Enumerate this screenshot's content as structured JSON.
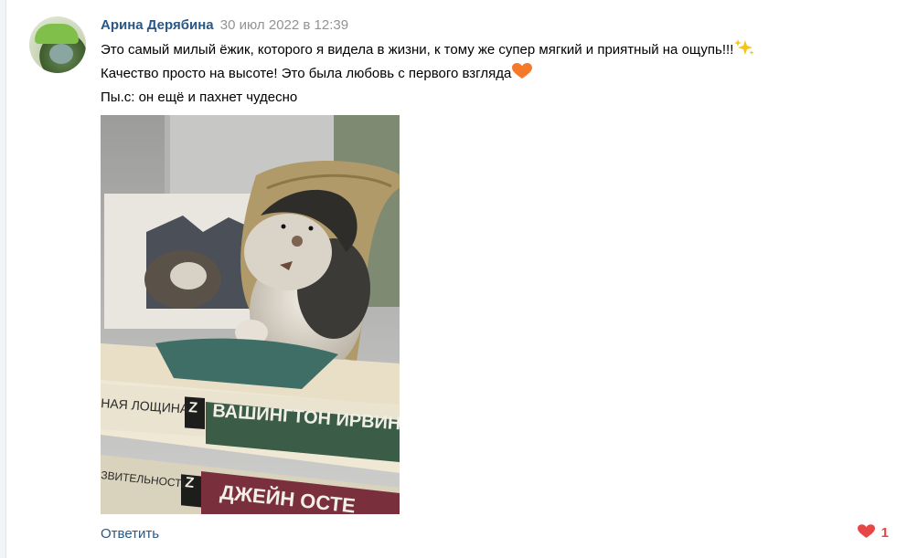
{
  "comment": {
    "author": "Арина Дерябина",
    "date": "30 июл 2022 в 12:39",
    "text_lines": [
      "Это самый милый ёжик, которого я видела в жизни, к тому же супер мягкий и приятный на ощупь!!!",
      "Качество просто на высоте! Это была любовь с первого взгляда",
      "Пы.с: он ещё и пахнет чудесно"
    ],
    "emoji_1": "sparkles-icon",
    "emoji_2": "orange-heart-icon",
    "photo": {
      "book_1_title": "НАЯ ЛОЩИНА",
      "book_1_author": "ВАШИНГТОН ИРВИНГ",
      "book_2_title": "ЗВИТЕЛЬНОСТЬ",
      "book_2_author": "ДЖЕЙН ОСТЕ",
      "series_logo": "Z"
    },
    "reply_label": "Ответить",
    "likes": "1",
    "like_icon": "heart-icon",
    "colors": {
      "link": "#2a5885",
      "date": "#939393",
      "like": "#e64646",
      "heart_orange": "#f4792b"
    }
  }
}
